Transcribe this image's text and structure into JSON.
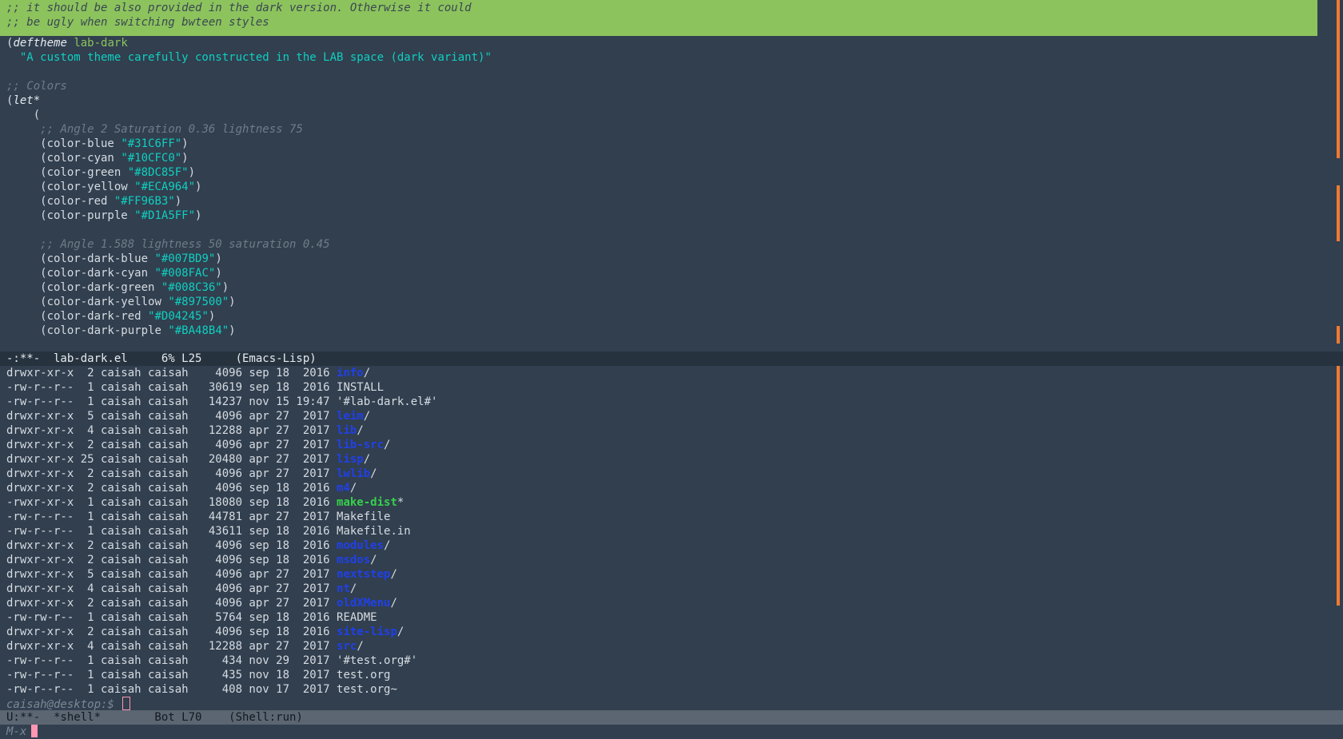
{
  "editor": {
    "comment_lines": [
      ";; it should be also provided in the dark version. Otherwise it could",
      ";; be ugly when switching bwteen styles"
    ],
    "deftheme_kw": "deftheme",
    "theme_name": "lab-dark",
    "docstring": "\"A custom theme carefully constructed in the LAB space (dark variant)\"",
    "colors_comment": ";; Colors",
    "let_kw": "let*",
    "angle2_comment": ";; Angle 2 Saturation 0.36 lightness 75",
    "light_colors": [
      {
        "name": "color-blue",
        "value": "\"#31C6FF\""
      },
      {
        "name": "color-cyan",
        "value": "\"#10CFC0\""
      },
      {
        "name": "color-green",
        "value": "\"#8DC85F\""
      },
      {
        "name": "color-yellow",
        "value": "\"#ECA964\""
      },
      {
        "name": "color-red",
        "value": "\"#FF96B3\""
      },
      {
        "name": "color-purple",
        "value": "\"#D1A5FF\""
      }
    ],
    "angle1_comment": ";; Angle 1.588 lightness 50 saturation 0.45",
    "dark_colors": [
      {
        "name": "color-dark-blue",
        "value": "\"#007BD9\""
      },
      {
        "name": "color-dark-cyan",
        "value": "\"#008FAC\""
      },
      {
        "name": "color-dark-green",
        "value": "\"#008C36\""
      },
      {
        "name": "color-dark-yellow",
        "value": "\"#897500\""
      },
      {
        "name": "color-dark-red",
        "value": "\"#D04245\""
      },
      {
        "name": "color-dark-purple",
        "value": "\"#BA48B4\""
      }
    ]
  },
  "modeline_top": "-:**-  lab-dark.el     6% L25     (Emacs-Lisp)",
  "listing": [
    {
      "meta": "drwxr-xr-x  2 caisah caisah    4096 sep 18  2016 ",
      "name": "info",
      "suffix": "/",
      "kind": "dir"
    },
    {
      "meta": "-rw-r--r--  1 caisah caisah   30619 sep 18  2016 ",
      "name": "INSTALL",
      "suffix": "",
      "kind": "file"
    },
    {
      "meta": "-rw-r--r--  1 caisah caisah   14237 nov 15 19:47 ",
      "name": "'#lab-dark.el#'",
      "suffix": "",
      "kind": "file"
    },
    {
      "meta": "drwxr-xr-x  5 caisah caisah    4096 apr 27  2017 ",
      "name": "leim",
      "suffix": "/",
      "kind": "dir"
    },
    {
      "meta": "drwxr-xr-x  4 caisah caisah   12288 apr 27  2017 ",
      "name": "lib",
      "suffix": "/",
      "kind": "dir"
    },
    {
      "meta": "drwxr-xr-x  2 caisah caisah    4096 apr 27  2017 ",
      "name": "lib-src",
      "suffix": "/",
      "kind": "dir"
    },
    {
      "meta": "drwxr-xr-x 25 caisah caisah   20480 apr 27  2017 ",
      "name": "lisp",
      "suffix": "/",
      "kind": "dir"
    },
    {
      "meta": "drwxr-xr-x  2 caisah caisah    4096 apr 27  2017 ",
      "name": "lwlib",
      "suffix": "/",
      "kind": "dir"
    },
    {
      "meta": "drwxr-xr-x  2 caisah caisah    4096 sep 18  2016 ",
      "name": "m4",
      "suffix": "/",
      "kind": "dir"
    },
    {
      "meta": "-rwxr-xr-x  1 caisah caisah   18080 sep 18  2016 ",
      "name": "make-dist",
      "suffix": "*",
      "kind": "exe"
    },
    {
      "meta": "-rw-r--r--  1 caisah caisah   44781 apr 27  2017 ",
      "name": "Makefile",
      "suffix": "",
      "kind": "file"
    },
    {
      "meta": "-rw-r--r--  1 caisah caisah   43611 sep 18  2016 ",
      "name": "Makefile.in",
      "suffix": "",
      "kind": "file"
    },
    {
      "meta": "drwxr-xr-x  2 caisah caisah    4096 sep 18  2016 ",
      "name": "modules",
      "suffix": "/",
      "kind": "dir"
    },
    {
      "meta": "drwxr-xr-x  2 caisah caisah    4096 sep 18  2016 ",
      "name": "msdos",
      "suffix": "/",
      "kind": "dir"
    },
    {
      "meta": "drwxr-xr-x  5 caisah caisah    4096 apr 27  2017 ",
      "name": "nextstep",
      "suffix": "/",
      "kind": "dir"
    },
    {
      "meta": "drwxr-xr-x  4 caisah caisah    4096 apr 27  2017 ",
      "name": "nt",
      "suffix": "/",
      "kind": "dir"
    },
    {
      "meta": "drwxr-xr-x  2 caisah caisah    4096 apr 27  2017 ",
      "name": "oldXMenu",
      "suffix": "/",
      "kind": "dir"
    },
    {
      "meta": "-rw-rw-r--  1 caisah caisah    5764 sep 18  2016 ",
      "name": "README",
      "suffix": "",
      "kind": "file"
    },
    {
      "meta": "drwxr-xr-x  2 caisah caisah    4096 sep 18  2016 ",
      "name": "site-lisp",
      "suffix": "/",
      "kind": "dir"
    },
    {
      "meta": "drwxr-xr-x  4 caisah caisah   12288 apr 27  2017 ",
      "name": "src",
      "suffix": "/",
      "kind": "dir"
    },
    {
      "meta": "-rw-r--r--  1 caisah caisah     434 nov 29  2017 ",
      "name": "'#test.org#'",
      "suffix": "",
      "kind": "file"
    },
    {
      "meta": "-rw-r--r--  1 caisah caisah     435 nov 18  2017 ",
      "name": "test.org",
      "suffix": "",
      "kind": "file"
    },
    {
      "meta": "-rw-r--r--  1 caisah caisah     408 nov 17  2017 ",
      "name": "test.org~",
      "suffix": "",
      "kind": "file"
    }
  ],
  "prompt": "caisah@desktop:$ ",
  "modeline_bottom": "U:**-  *shell*        Bot L70    (Shell:run)",
  "minibuffer": "M-x"
}
